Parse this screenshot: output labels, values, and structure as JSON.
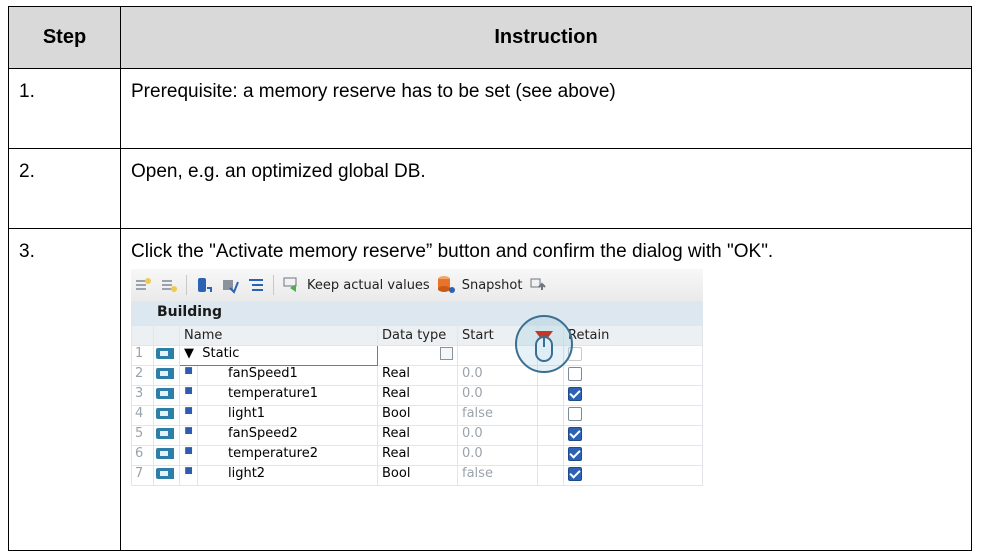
{
  "table": {
    "header_step": "Step",
    "header_instruction": "Instruction",
    "rows": [
      {
        "step": "1.",
        "instruction": "Prerequisite: a memory reserve has to be set (see above)"
      },
      {
        "step": "2.",
        "instruction": "Open, e.g. an optimized global DB."
      },
      {
        "step": "3.",
        "instruction": "Click the \"Activate memory reserve” button and confirm the dialog with \"OK\"."
      }
    ]
  },
  "tia": {
    "toolbar": {
      "keep_actual_values": "Keep actual values",
      "snapshot": "Snapshot"
    },
    "db_name": "Building",
    "columns": {
      "name": "Name",
      "data_type": "Data type",
      "start": "Start",
      "retain": "Retain"
    },
    "rows": [
      {
        "num": "1",
        "name": "Static",
        "type": "",
        "start": "",
        "retain": "disabled"
      },
      {
        "num": "2",
        "name": "fanSpeed1",
        "type": "Real",
        "start": "0.0",
        "retain": "unchecked"
      },
      {
        "num": "3",
        "name": "temperature1",
        "type": "Real",
        "start": "0.0",
        "retain": "checked"
      },
      {
        "num": "4",
        "name": "light1",
        "type": "Bool",
        "start": "false",
        "retain": "unchecked"
      },
      {
        "num": "5",
        "name": "fanSpeed2",
        "type": "Real",
        "start": "0.0",
        "retain": "checked"
      },
      {
        "num": "6",
        "name": "temperature2",
        "type": "Real",
        "start": "0.0",
        "retain": "checked"
      },
      {
        "num": "7",
        "name": "light2",
        "type": "Bool",
        "start": "false",
        "retain": "checked"
      }
    ],
    "colors": {
      "accent": "#2c62b3",
      "header_bg": "#dde7ef",
      "activate_icon": "#e8742a"
    }
  }
}
